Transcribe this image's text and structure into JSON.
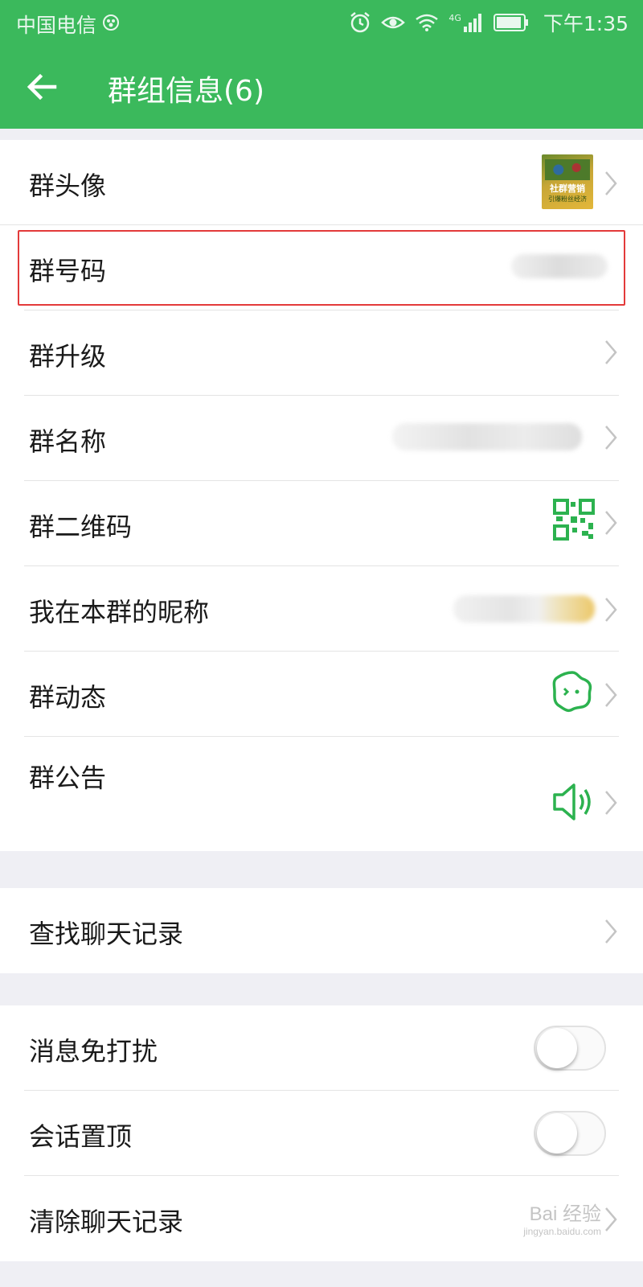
{
  "status_bar": {
    "carrier": "中国电信",
    "time": "下午1:35",
    "network": "4G",
    "icons": [
      "paw-icon",
      "alarm-icon",
      "eye-icon",
      "wifi-icon",
      "signal-icon",
      "battery-icon"
    ]
  },
  "app_bar": {
    "title": "群组信息(6)",
    "back_icon": "back-arrow-icon"
  },
  "colors": {
    "brand_green": "#3bb95c",
    "highlight_red": "#e33a3a",
    "background": "#efeff4"
  },
  "group_info": {
    "items": [
      {
        "label": "群头像",
        "value_type": "image",
        "icon": "book-cover-thumbnail",
        "chevron": true
      },
      {
        "label": "群号码",
        "value_type": "redacted",
        "chevron": false,
        "highlighted": true
      },
      {
        "label": "群升级",
        "value_type": "none",
        "chevron": true
      },
      {
        "label": "群名称",
        "value_type": "redacted",
        "chevron": true
      },
      {
        "label": "群二维码",
        "value_type": "icon",
        "icon": "qr-code-icon",
        "chevron": true
      },
      {
        "label": "我在本群的昵称",
        "value_type": "redacted",
        "chevron": true
      },
      {
        "label": "群动态",
        "value_type": "icon",
        "icon": "sparkle-face-icon",
        "chevron": true
      },
      {
        "label": "群公告",
        "value_type": "icon",
        "icon": "speaker-icon",
        "chevron": true
      }
    ],
    "avatar_thumbnail": {
      "line1": "社群营销",
      "line2": "引爆粉丝经济"
    }
  },
  "search_section": {
    "label": "查找聊天记录"
  },
  "settings": {
    "mute_label": "消息免打扰",
    "mute_on": false,
    "pin_label": "会话置顶",
    "pin_on": false,
    "clear_label": "清除聊天记录"
  },
  "watermark": {
    "text": "Bai 经验",
    "sub": "jingyan.baidu.com"
  }
}
